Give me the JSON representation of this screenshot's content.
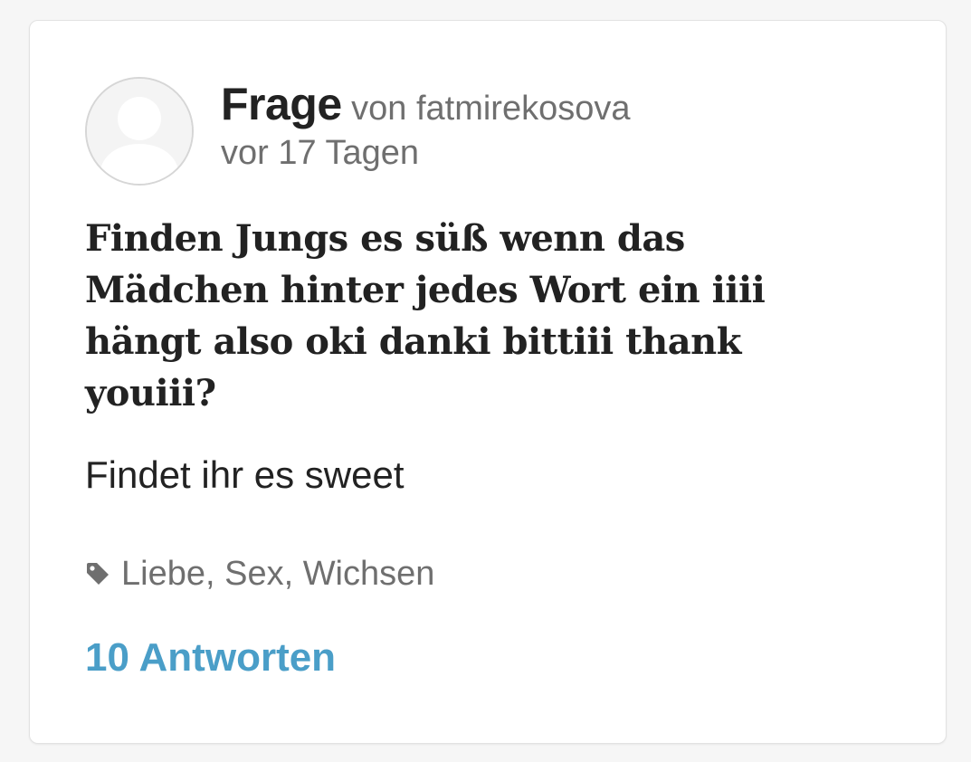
{
  "question": {
    "label": "Frage",
    "author_prefix": "von fatmirekosova",
    "time_ago": "vor 17 Tagen",
    "title": "Finden Jungs es süß wenn das Mädchen hinter jedes Wort ein iiii hängt also oki danki bittiii thank youiii?",
    "body": "Findet ihr es sweet",
    "tags": "Liebe, Sex, Wichsen",
    "answers_link": "10 Antworten"
  },
  "icons": {
    "avatar": "default-user-avatar-icon",
    "tags": "tag-icon"
  },
  "colors": {
    "accent": "#4a9ec8",
    "text_primary": "#222222",
    "text_secondary": "#6f6f6f",
    "background": "#f6f6f6",
    "card": "#ffffff"
  }
}
